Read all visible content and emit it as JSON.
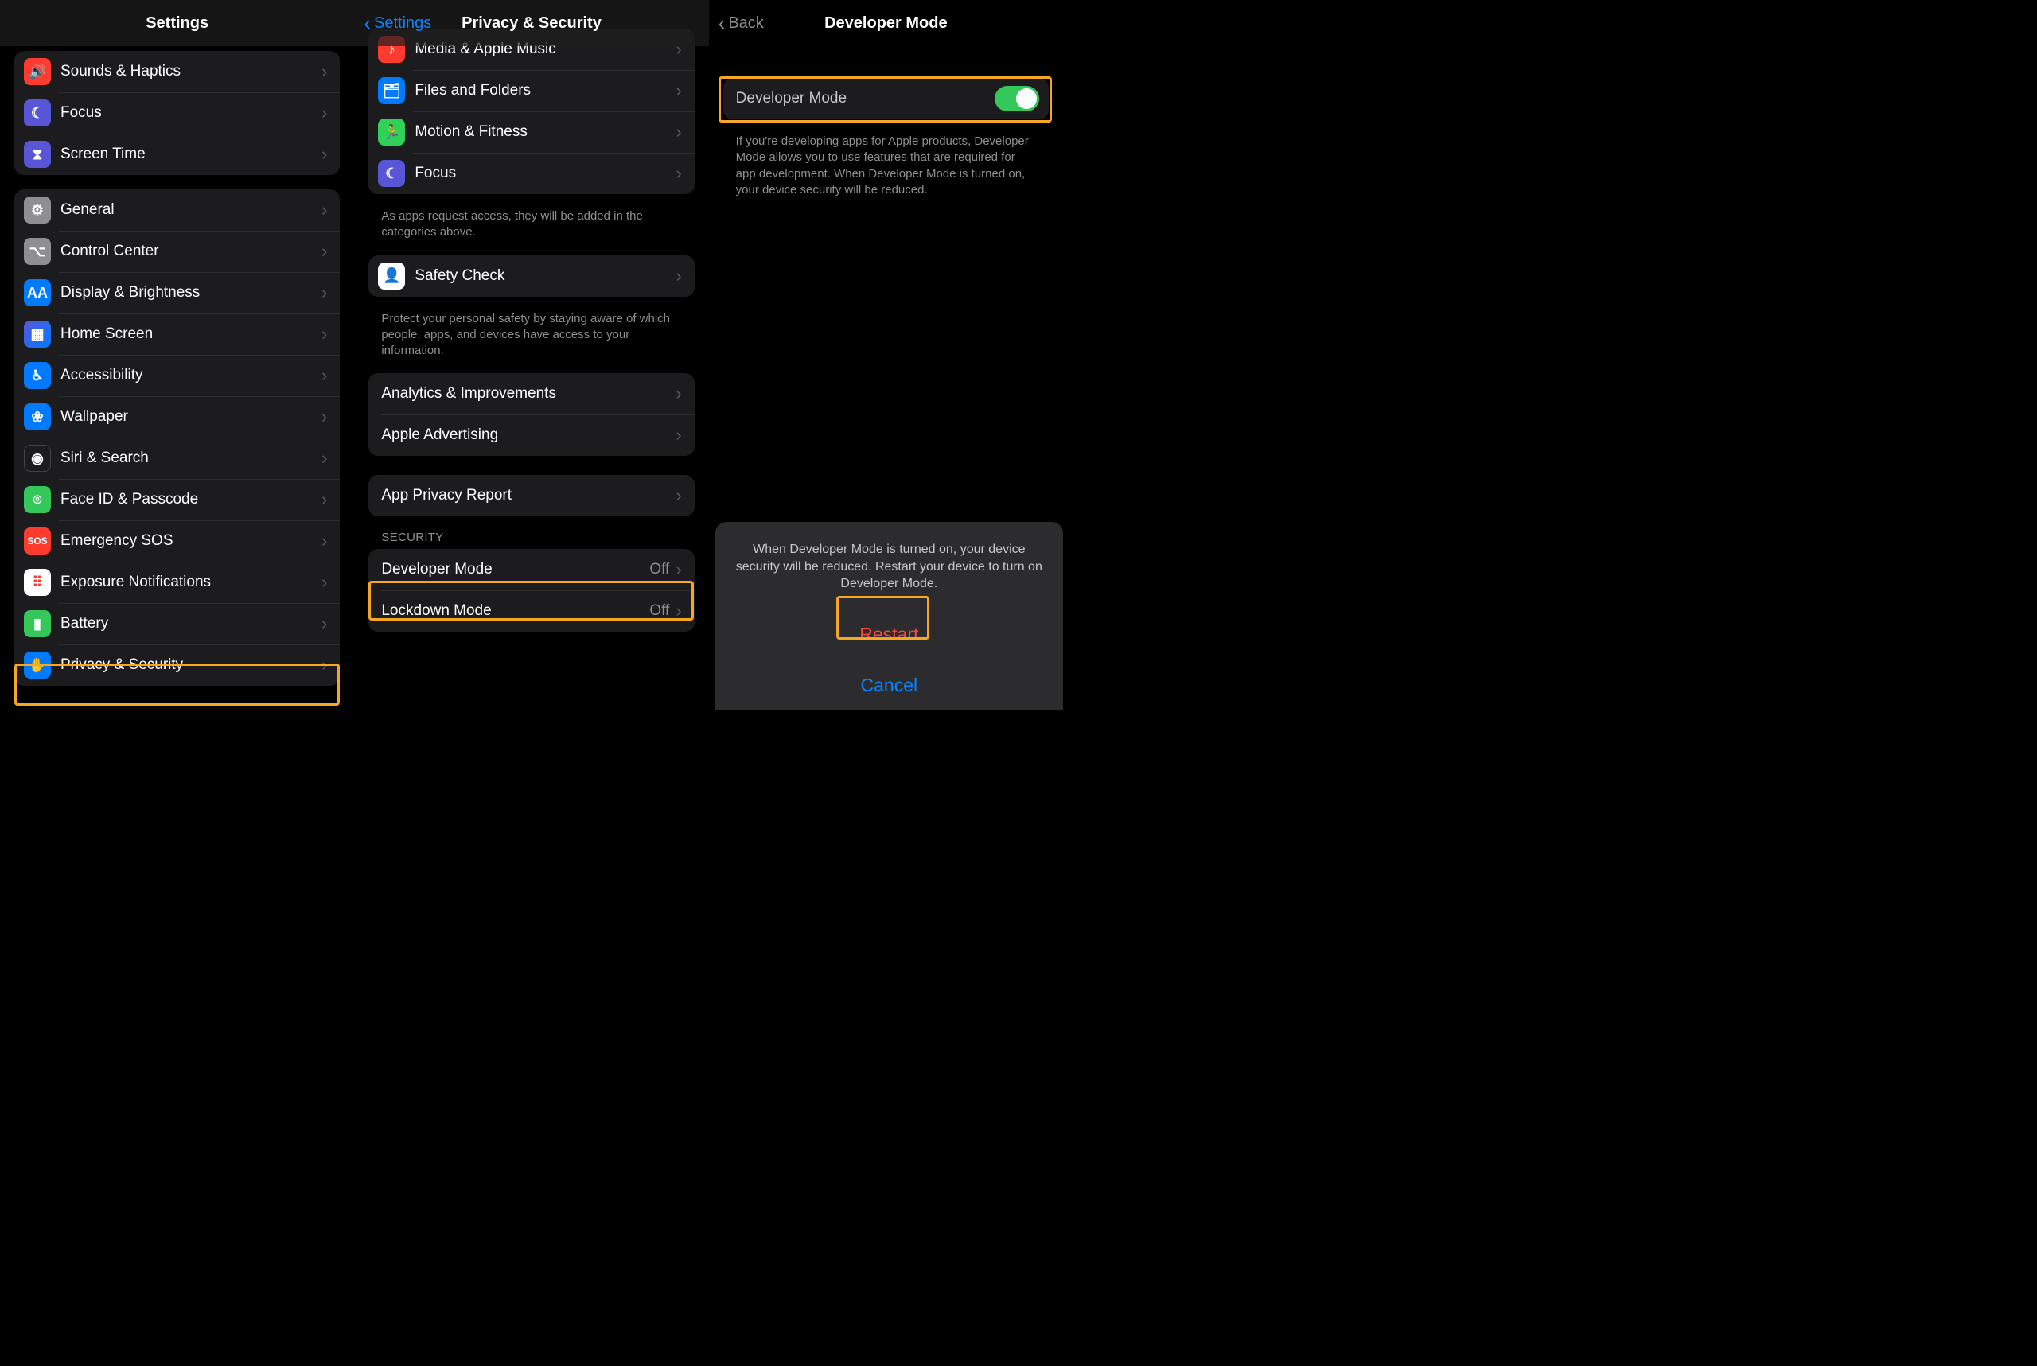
{
  "pane1": {
    "title": "Settings",
    "group1": [
      {
        "label": "Sounds & Haptics",
        "icon": "sounds-icon",
        "color": "ic-red",
        "glyph": "🔊"
      },
      {
        "label": "Focus",
        "icon": "focus-icon",
        "color": "ic-purple",
        "glyph": "☾"
      },
      {
        "label": "Screen Time",
        "icon": "screentime-icon",
        "color": "ic-purple",
        "glyph": "⧗"
      }
    ],
    "group2": [
      {
        "label": "General",
        "icon": "general-icon",
        "color": "ic-gray",
        "glyph": "⚙"
      },
      {
        "label": "Control Center",
        "icon": "controlcenter-icon",
        "color": "ic-gray",
        "glyph": "⌥"
      },
      {
        "label": "Display & Brightness",
        "icon": "display-icon",
        "color": "ic-blue",
        "glyph": "AA"
      },
      {
        "label": "Home Screen",
        "icon": "homescreen-icon",
        "color": "ic-home",
        "glyph": "▦"
      },
      {
        "label": "Accessibility",
        "icon": "accessibility-icon",
        "color": "ic-blue",
        "glyph": "♿︎"
      },
      {
        "label": "Wallpaper",
        "icon": "wallpaper-icon",
        "color": "ic-blue",
        "glyph": "❀"
      },
      {
        "label": "Siri & Search",
        "icon": "siri-icon",
        "color": "ic-black",
        "glyph": "◉"
      },
      {
        "label": "Face ID & Passcode",
        "icon": "faceid-icon",
        "color": "ic-green",
        "glyph": "⌾"
      },
      {
        "label": "Emergency SOS",
        "icon": "sos-icon",
        "color": "ic-sos",
        "glyph": "SOS"
      },
      {
        "label": "Exposure Notifications",
        "icon": "exposure-icon",
        "color": "ic-white",
        "glyph": "⠿"
      },
      {
        "label": "Battery",
        "icon": "battery-icon",
        "color": "ic-green",
        "glyph": "▮"
      },
      {
        "label": "Privacy & Security",
        "icon": "privacy-icon",
        "color": "ic-blue",
        "glyph": "✋"
      }
    ]
  },
  "pane2": {
    "back": "Settings",
    "title": "Privacy & Security",
    "group_apps": [
      {
        "label": "Media & Apple Music",
        "icon": "music-icon",
        "color": "ic-red",
        "glyph": "♪"
      },
      {
        "label": "Files and Folders",
        "icon": "files-icon",
        "color": "ic-blue",
        "glyph": "🗂"
      },
      {
        "label": "Motion & Fitness",
        "icon": "motion-icon",
        "color": "ic-teal",
        "glyph": "🏃"
      },
      {
        "label": "Focus",
        "icon": "focus2-icon",
        "color": "ic-purple",
        "glyph": "☾"
      }
    ],
    "apps_footer": "As apps request access, they will be added in the categories above.",
    "safety": {
      "label": "Safety Check",
      "icon": "safety-icon",
      "glyph": "👤"
    },
    "safety_footer": "Protect your personal safety by staying aware of which people, apps, and devices have access to your information.",
    "analytics": [
      {
        "label": "Analytics & Improvements"
      },
      {
        "label": "Apple Advertising"
      }
    ],
    "report": {
      "label": "App Privacy Report"
    },
    "security_header": "SECURITY",
    "security": [
      {
        "label": "Developer Mode",
        "detail": "Off"
      },
      {
        "label": "Lockdown Mode",
        "detail": "Off"
      }
    ]
  },
  "pane3": {
    "back": "Back",
    "title": "Developer Mode",
    "toggle": {
      "label": "Developer Mode",
      "on": true
    },
    "footer": "If you're developing apps for Apple products, Developer Mode allows you to use features that are required for app development. When Developer Mode is turned on, your device security will be reduced.",
    "sheet": {
      "message": "When Developer Mode is turned on, your device security will be reduced. Restart your device to turn on Developer Mode.",
      "restart": "Restart",
      "cancel": "Cancel"
    }
  }
}
